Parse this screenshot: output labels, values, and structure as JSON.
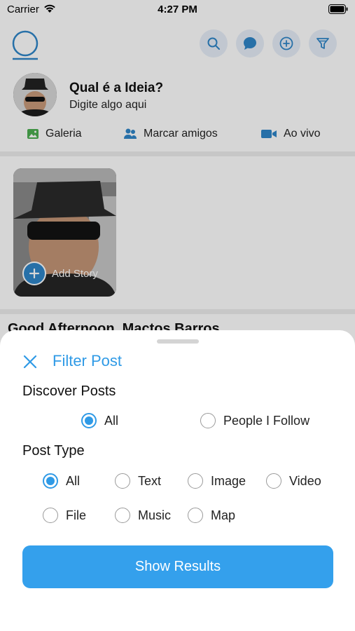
{
  "status_bar": {
    "carrier": "Carrier",
    "time": "4:27 PM"
  },
  "composer": {
    "title": "Qual é a Ideia?",
    "placeholder": "Digite algo aqui"
  },
  "quick_actions": {
    "gallery": "Galeria",
    "tag_friends": "Marcar amigos",
    "live": "Ao vivo"
  },
  "story": {
    "add_label": "Add Story"
  },
  "feed": {
    "greeting": "Good Afternoon, Mactos Barros"
  },
  "filter_sheet": {
    "title": "Filter Post",
    "discover_title": "Discover Posts",
    "discover_options": [
      {
        "label": "All",
        "selected": true
      },
      {
        "label": "People I Follow",
        "selected": false
      }
    ],
    "type_title": "Post Type",
    "type_options": [
      {
        "label": "All",
        "selected": true
      },
      {
        "label": "Text",
        "selected": false
      },
      {
        "label": "Image",
        "selected": false
      },
      {
        "label": "Video",
        "selected": false
      },
      {
        "label": "File",
        "selected": false
      },
      {
        "label": "Music",
        "selected": false
      },
      {
        "label": "Map",
        "selected": false
      }
    ],
    "submit_label": "Show Results"
  },
  "icons": {
    "logo": "logo-ring-icon",
    "search": "search-icon",
    "chat": "chat-bubble-icon",
    "add": "add-circle-icon",
    "filter": "filter-funnel-icon",
    "gallery": "gallery-icon",
    "people": "people-icon",
    "video": "video-camera-icon",
    "close": "close-icon"
  },
  "colors": {
    "accent": "#2f9ae6",
    "button": "#34a0ec",
    "icon_blue": "#2f86c9"
  }
}
